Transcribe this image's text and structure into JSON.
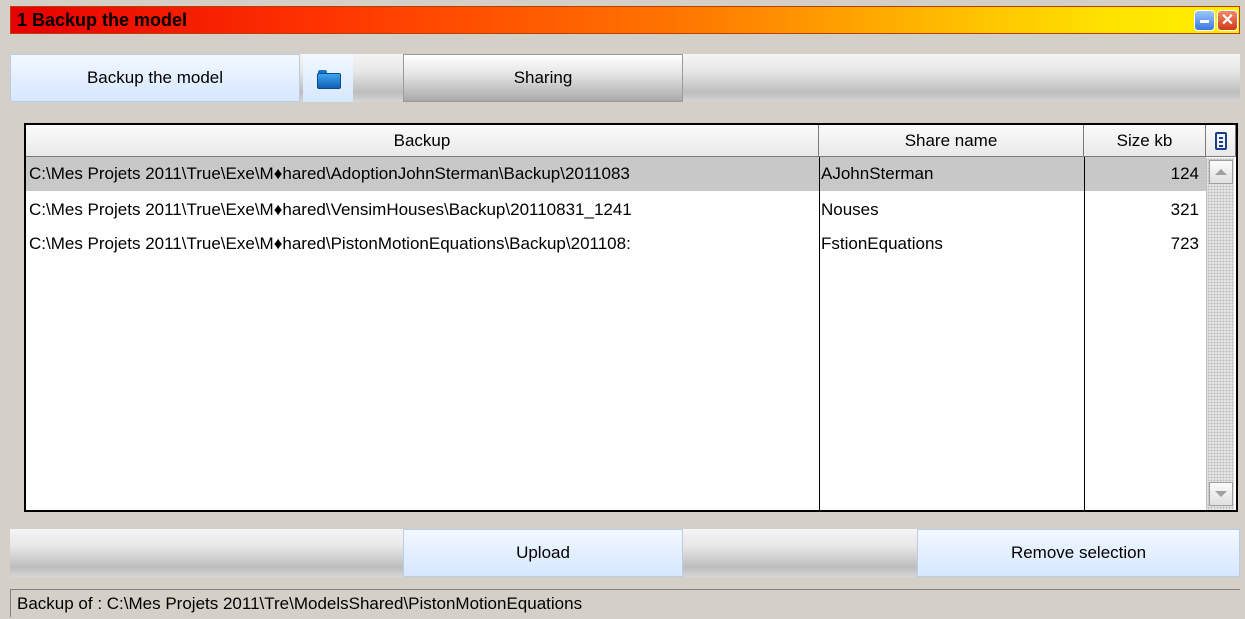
{
  "window": {
    "title": "1  Backup the model"
  },
  "toolbar": {
    "backup_label": "Backup the model",
    "sharing_label": "Sharing"
  },
  "table": {
    "headers": [
      "Backup",
      "Share name",
      "Size kb"
    ],
    "rows": [
      {
        "backup": "C:\\Mes Projets 2011\\True\\Exe\\M♦hared\\AdoptionJohnSterman\\Backup\\2011083",
        "share": "AJohnSterman",
        "size": "124",
        "selected": true
      },
      {
        "backup": "C:\\Mes Projets 2011\\True\\Exe\\M♦hared\\VensimHouses\\Backup\\20110831_1241",
        "share": "Nouses",
        "size": "321",
        "selected": false
      },
      {
        "backup": "C:\\Mes Projets 2011\\True\\Exe\\M♦hared\\PistonMotionEquations\\Backup\\201108:",
        "share": "FstionEquations",
        "size": "723",
        "selected": false
      }
    ]
  },
  "actions": {
    "upload_label": "Upload",
    "remove_label": "Remove selection"
  },
  "status": {
    "text": "Backup of : C:\\Mes Projets 2011\\Tre\\ModelsShared\\PistonMotionEquations"
  },
  "icons": {
    "folder": "folder-icon",
    "minimize": "minimize-icon",
    "close": "close-icon",
    "columns": "column-chooser-icon"
  }
}
